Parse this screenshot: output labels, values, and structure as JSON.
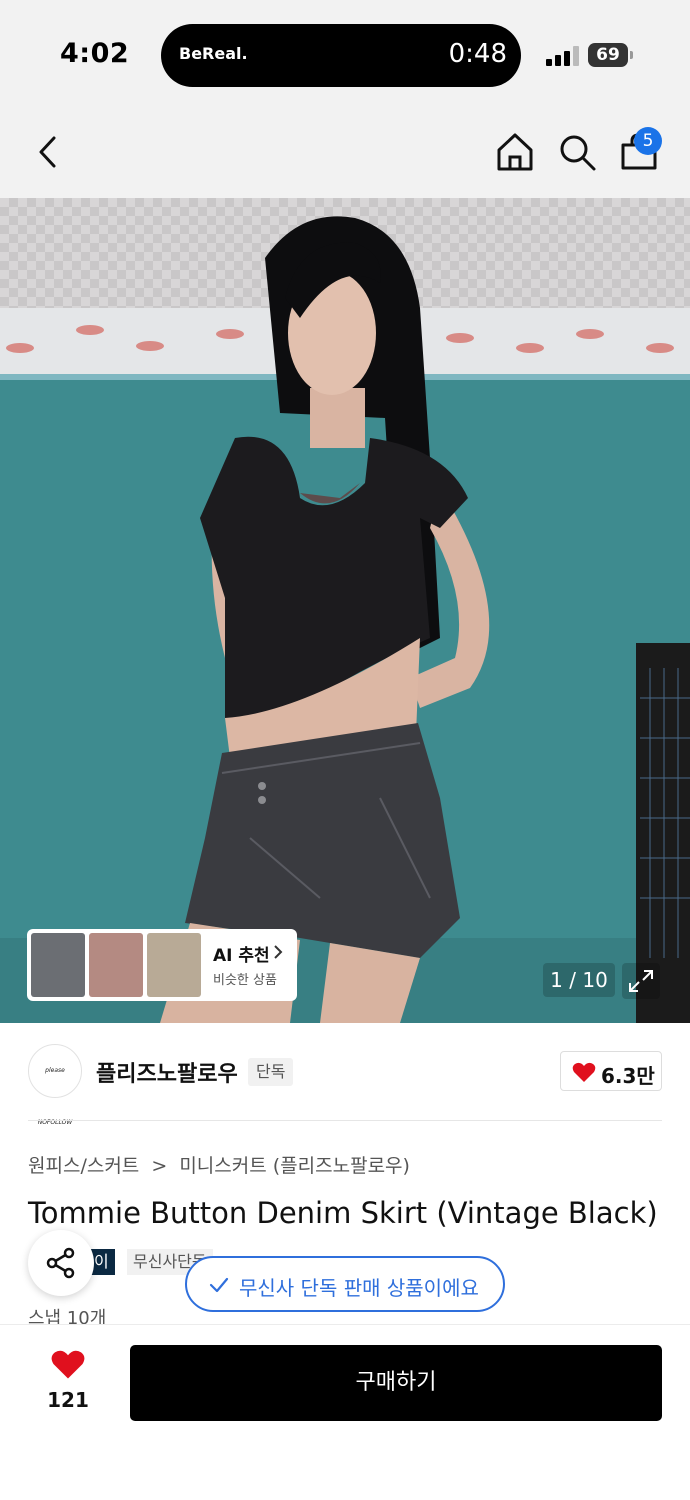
{
  "status_bar": {
    "time": "4:02",
    "island_app": "BeReal.",
    "island_timer": "0:48",
    "battery": "69"
  },
  "nav": {
    "cart_count": "5",
    "icons": [
      "back-icon",
      "home-icon",
      "search-icon",
      "cart-icon"
    ]
  },
  "gallery": {
    "page_counter": "1 / 10",
    "ai_card": {
      "title": "AI 추천",
      "subtitle": "비슷한 상품"
    }
  },
  "brand": {
    "name": "플리즈노팔로우",
    "exclusive_tag": "단독",
    "like_count": "6.3만",
    "logo_text": "please NOFOLLOW"
  },
  "breadcrumb": {
    "category": "원피스/스커트",
    "separator": ">",
    "subcategory": "미니스커트 (플리즈노팔로우)"
  },
  "product": {
    "title": "Tommie Button Denim Skirt (Vintage Black)",
    "tag_dark": "이",
    "tag_light": "무신사단독",
    "snap_count": "스냅 10개"
  },
  "toast": {
    "text": "무신사 단독 판매 상품이에요"
  },
  "bottom_bar": {
    "wish_count": "121",
    "buy_label": "구매하기"
  },
  "colors": {
    "accent_blue": "#2f6fdc",
    "badge_blue": "#1a73e8",
    "heart_red": "#e0101e",
    "buy_black": "#000000"
  }
}
